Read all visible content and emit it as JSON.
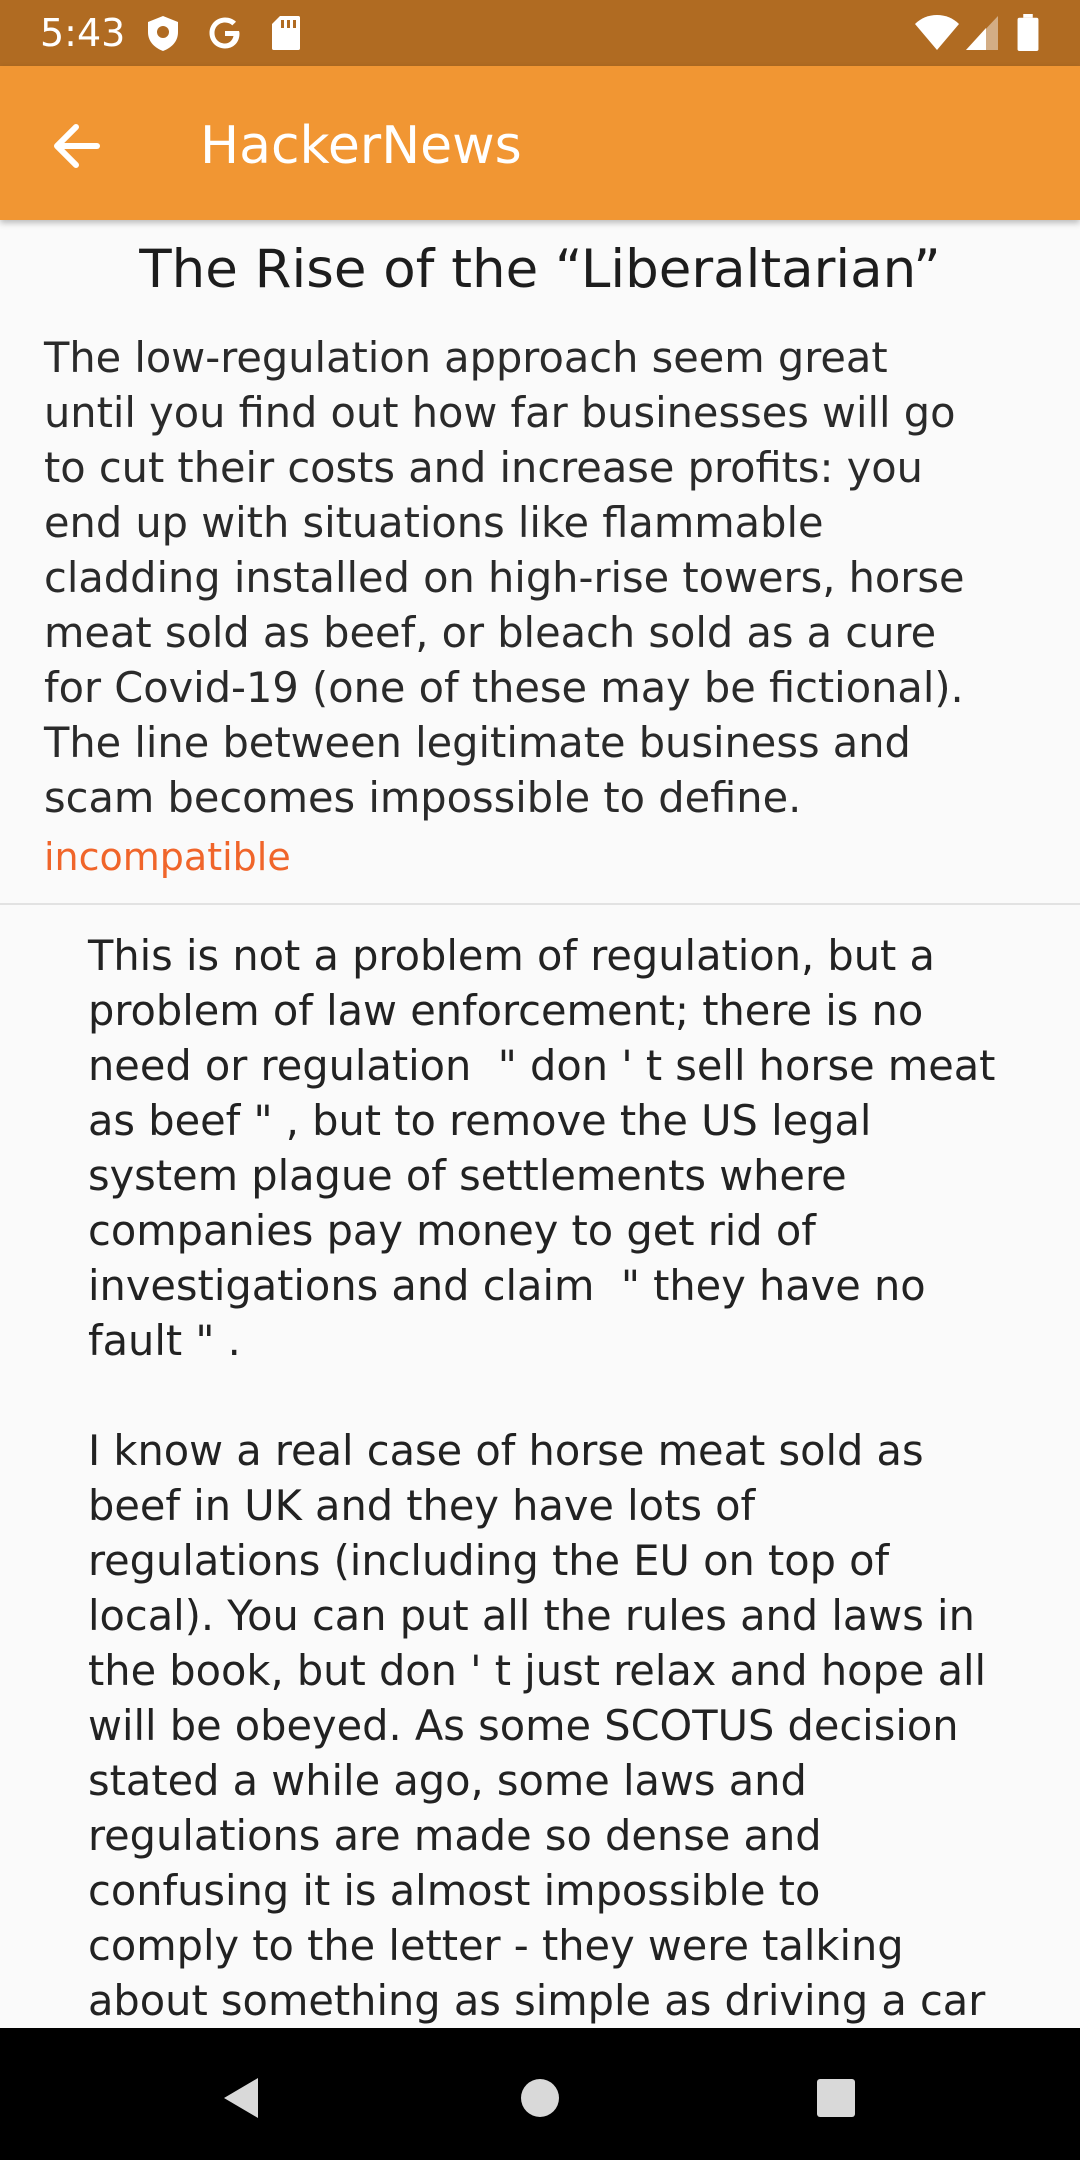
{
  "status_bar": {
    "time": "5:43",
    "icons": [
      "shield-icon",
      "google-icon",
      "sd-card-icon",
      "wifi-icon",
      "signal-icon",
      "battery-icon"
    ]
  },
  "app_bar": {
    "title": "HackerNews",
    "back_icon": "arrow-back-icon",
    "background_color": "#f19633"
  },
  "story": {
    "title": "The Rise of the “Liberaltarian”",
    "text_lines": [
      "The low-regulation approach seem great",
      "until you find out how far businesses will go",
      "to cut their costs and increase profits: you",
      "end up with situations like flammable",
      "cladding installed on high-rise towers, horse",
      "meat sold as beef, or bleach sold as a cure",
      "for Covid-19 (one of these may be fictional).",
      "The line between legitimate business and",
      "scam becomes impossible to define."
    ],
    "tag": "incompatible",
    "tag_color": "#f0652a"
  },
  "comment": {
    "text_lines": [
      "This is not a problem of regulation, but a",
      "problem of law enforcement; there is no",
      "need or regulation  \" don ' t sell horse meat",
      "as beef \" , but to remove the US legal",
      "system plague of settlements where",
      "companies pay money to get rid of",
      "investigations and claim  \" they have no",
      "fault \" .",
      "",
      "I know a real case of horse meat sold as",
      "beef in UK and they have lots of",
      "regulations (including the EU on top of",
      "local). You can put all the rules and laws in",
      "the book, but don ' t just relax and hope all",
      "will be obeyed. As some SCOTUS decision",
      "stated a while ago, some laws and",
      "regulations are made so dense and",
      "confusing it is almost impossible to",
      "comply to the letter - they were talking",
      "about something as simple as driving a car"
    ]
  },
  "nav_bar": {
    "buttons": [
      "back-triangle-icon",
      "home-circle-icon",
      "recents-square-icon"
    ]
  }
}
